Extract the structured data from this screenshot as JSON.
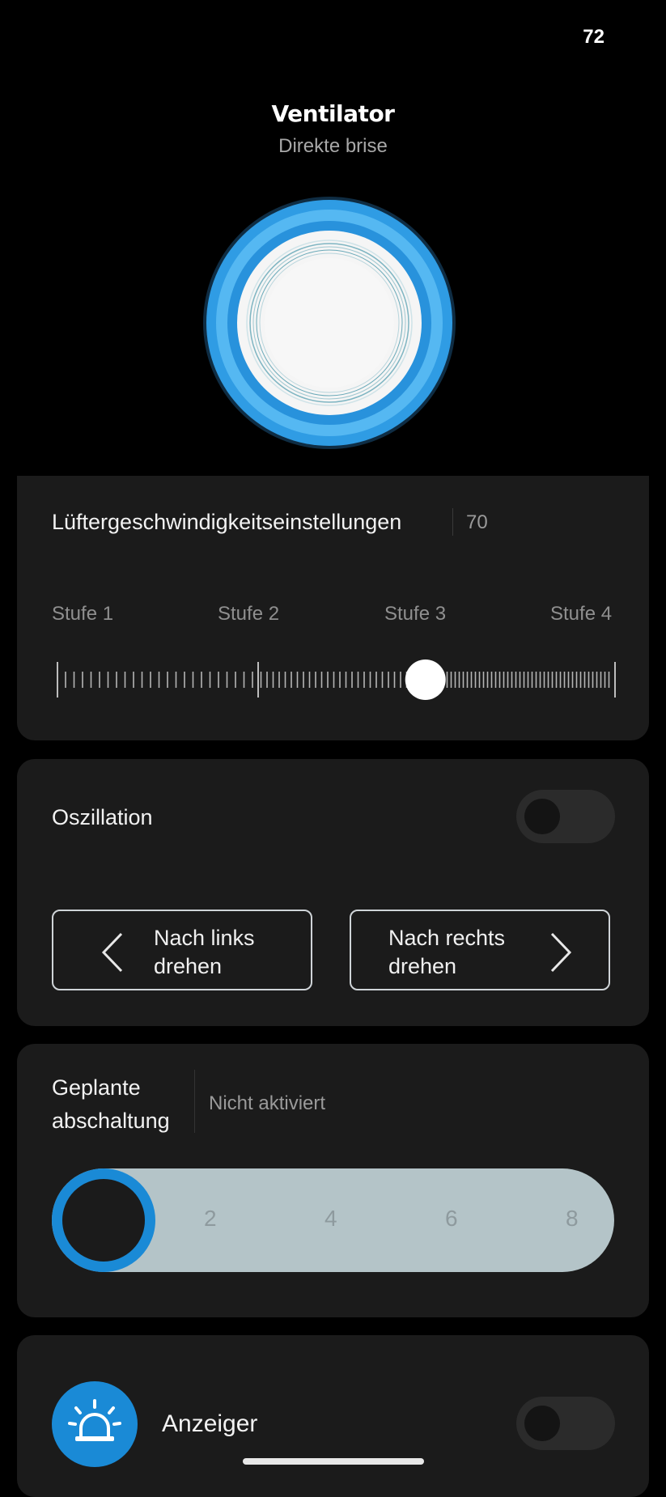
{
  "status": {
    "number": "72"
  },
  "header": {
    "title": "Ventilator",
    "subtitle": "Direkte brise"
  },
  "colors": {
    "accent": "#1a8ad6",
    "ring_light": "#4ab0ee",
    "card": "#1b1b1b"
  },
  "speed": {
    "title": "Lüftergeschwindigkeitseinstellungen",
    "value": "70",
    "level_fraction": 0.66,
    "stages": [
      "Stufe 1",
      "Stufe 2",
      "Stufe 3",
      "Stufe 4"
    ]
  },
  "oscillation": {
    "label": "Oszillation",
    "enabled": false,
    "left_button": "Nach links\ndrehen",
    "right_button": "Nach rechts\ndrehen"
  },
  "timer": {
    "label": "Geplante\nabschaltung",
    "status": "Nicht aktiviert",
    "marks": [
      "2",
      "4",
      "6",
      "8"
    ],
    "selected_hours": 0
  },
  "indicator": {
    "label": "Anzeiger",
    "icon": "alarm-light-icon",
    "enabled": false
  }
}
